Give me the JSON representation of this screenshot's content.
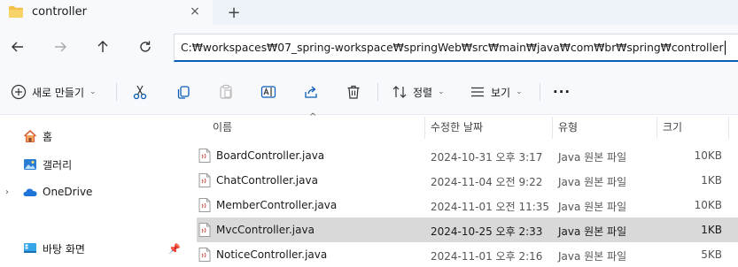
{
  "tab": {
    "title": "controller",
    "close_label": "×",
    "new_tab_label": "+"
  },
  "address": {
    "path": "C:₩workspaces₩07_spring-workspace₩springWeb₩src₩main₩java₩com₩br₩spring₩controller"
  },
  "toolbar": {
    "new_label": "새로 만들기",
    "sort_label": "정렬",
    "view_label": "보기",
    "more_label": "···"
  },
  "sidebar": {
    "items": [
      {
        "label": "홈",
        "icon": "home-icon"
      },
      {
        "label": "갤러리",
        "icon": "gallery-icon"
      },
      {
        "label": "OneDrive",
        "icon": "onedrive-icon"
      },
      {
        "label": "바탕 화면",
        "icon": "desktop-icon"
      }
    ]
  },
  "columns": {
    "name": "이름",
    "modified": "수정한 날짜",
    "type": "유형",
    "size": "크기"
  },
  "files": [
    {
      "name": "BoardController.java",
      "modified": "2024-10-31 오후 3:17",
      "type": "Java 원본 파일",
      "size": "10KB",
      "selected": false
    },
    {
      "name": "ChatController.java",
      "modified": "2024-11-04 오전 9:22",
      "type": "Java 원본 파일",
      "size": "1KB",
      "selected": false
    },
    {
      "name": "MemberController.java",
      "modified": "2024-11-01 오전 11:35",
      "type": "Java 원본 파일",
      "size": "10KB",
      "selected": false
    },
    {
      "name": "MvcController.java",
      "modified": "2024-10-25 오후 2:33",
      "type": "Java 원본 파일",
      "size": "1KB",
      "selected": true
    },
    {
      "name": "NoticeController.java",
      "modified": "2024-11-01 오후 2:16",
      "type": "Java 원본 파일",
      "size": "5KB",
      "selected": false
    }
  ],
  "colors": {
    "accent": "#0a5db6",
    "folder": "#f3c14b",
    "selected_row": "#d9d9d9"
  }
}
